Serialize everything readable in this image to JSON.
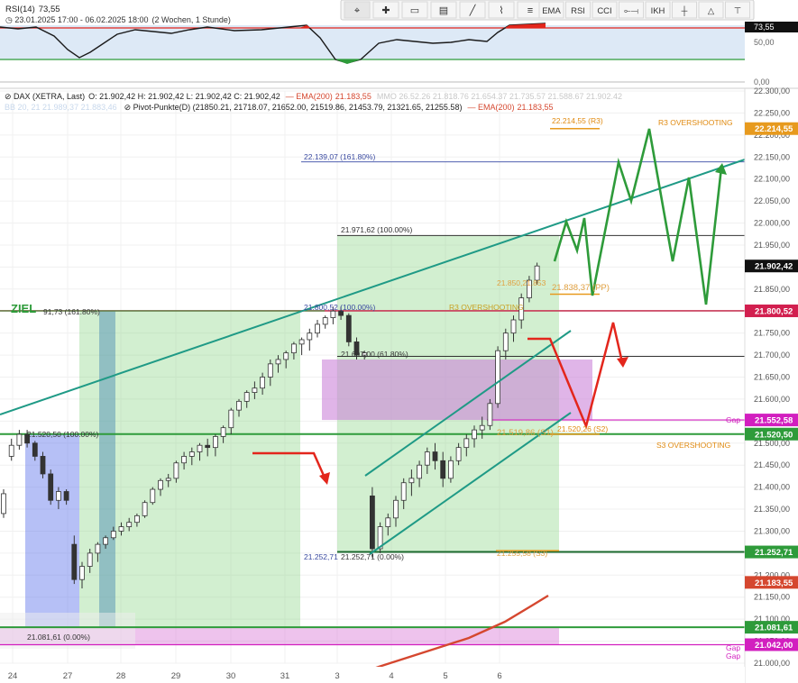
{
  "colors": {
    "green": "#2e9b3a",
    "teal": "#1f9a86",
    "red": "#e3261c",
    "magenta": "#d21fbf",
    "blue_zone": "#4f63e8",
    "green_zone": "#7bcf73",
    "purple_zone": "#a58ec7",
    "ema": "#d5472f",
    "price_tag_bg": "#111111"
  },
  "toolbar": {
    "icons": [
      "cursor-icon",
      "crosshair-icon",
      "rectangle-icon",
      "fibonacci-icon",
      "pencil-icon",
      "brush-icon",
      "lines-icon"
    ],
    "buttons": [
      "EMA",
      "RSI",
      "CCI",
      "⟜⟞",
      "IKH",
      "┼",
      "△",
      "⊤"
    ]
  },
  "rsi": {
    "title": "RSI(14)",
    "value": "73,55",
    "period": "23.01.2025 17:00 - 06.02.2025 18:00",
    "interval": "(2 Wochen, 1 Stunde)",
    "axis": [
      "73,55",
      "50,00",
      "0,00"
    ]
  },
  "legend": {
    "symbol": "DAX (XETRA, Last)",
    "ohlc": "O: 21.902,42  H: 21.902,42  L: 21.902,42  C: 21.902,42",
    "ema_label": "EMA(200)",
    "ema_value": "21.183,55",
    "faded1": "MMO 26.52.26  21.818.76  21.654.37  21.735.57  21.588.67  21.902.42",
    "faded2": "BB 20, 21 21.989,37  21.883,46",
    "pivot": "Pivot-Punkte(D) (21850.21, 21718.07, 21652.00, 21519.86, 21453.79, 21321.65, 21255.58)",
    "ema2_label": "EMA(200)",
    "ema2_value": "21.183,55"
  },
  "chart_data": {
    "type": "candlestick",
    "title": "DAX (XETRA, Last)",
    "ylim": [
      21015,
      22300
    ],
    "y_ticks": [
      "22.300,00",
      "22.250,00",
      "22.200,00",
      "22.150,00",
      "22.100,00",
      "22.050,00",
      "22.000,00",
      "21.950,00",
      "21.900,00",
      "21.850,00",
      "21.800,00",
      "21.750,00",
      "21.700,00",
      "21.650,00",
      "21.600,00",
      "21.550,00",
      "21.500,00",
      "21.450,00",
      "21.400,00",
      "21.350,00",
      "21.300,00",
      "21.250,00",
      "21.200,00",
      "21.150,00",
      "21.100,00",
      "21.050,00",
      "21.000,00"
    ],
    "x_ticks": [
      "24",
      "27",
      "28",
      "29",
      "30",
      "31",
      "3",
      "4",
      "5",
      "6"
    ],
    "price_tags": [
      {
        "label": "22.214,55",
        "value": 22214.55,
        "color": "#e79a1e"
      },
      {
        "label": "21.902,42",
        "value": 21902.42,
        "color": "#111111"
      },
      {
        "label": "21.800,52",
        "value": 21800.52,
        "color": "#d21f4f"
      },
      {
        "label": "21.552,58",
        "value": 21552.58,
        "color": "#d21fbf"
      },
      {
        "label": "21.520,50",
        "value": 21520.5,
        "color": "#2e9b3a"
      },
      {
        "label": "21.252,71",
        "value": 21252.71,
        "color": "#2e9b3a"
      },
      {
        "label": "21.183,55",
        "value": 21183.55,
        "color": "#d5472f"
      },
      {
        "label": "21.081,61",
        "value": 21081.61,
        "color": "#2e9b3a"
      },
      {
        "label": "21.042,00",
        "value": 21042.0,
        "color": "#d21fbf"
      }
    ],
    "annotations": [
      {
        "text": "22.214,55 (R3)",
        "value": 22214.55
      },
      {
        "text": "R3 OVERSHOOTING",
        "value": 22214.55
      },
      {
        "text": "22.139,07 (161.80%)",
        "value": 22139.07
      },
      {
        "text": "21.971,62 (100.00%)",
        "value": 21971.62
      },
      {
        "text": "21.850,21.853",
        "value": 21850.21
      },
      {
        "text": "21.838,37 (PP)",
        "value": 21838.37
      },
      {
        "text": "ZIEL",
        "value": 21800
      },
      {
        "text": "91,73 (161.80%)",
        "value": 21791.73
      },
      {
        "text": "21.800,52 (100.00%)",
        "value": 21800.52
      },
      {
        "text": "R3 OVERSHOOTING",
        "value": 21800
      },
      {
        "text": "21.697,00 (61.80%)",
        "value": 21697.0
      },
      {
        "text": "21.520,50 (100.00%)",
        "value": 21520.5
      },
      {
        "text": "21.519,86 (S1)",
        "value": 21519.86
      },
      {
        "text": "21.520,26 (S2)",
        "value": 21520.26
      },
      {
        "text": "S3 OVERSHOOTING",
        "value": 21515
      },
      {
        "text": "Gap",
        "value": 21560
      },
      {
        "text": "21.252,71",
        "value": 21252.71
      },
      {
        "text": "21.252,71 (0.00%)",
        "value": 21252.71
      },
      {
        "text": "21.255,58 (S3)",
        "value": 21255.58
      },
      {
        "text": "21.081,61 (0.00%)",
        "value": 21081.61
      },
      {
        "text": "Gap",
        "value": 21070
      },
      {
        "text": "Gap",
        "value": 21048
      }
    ],
    "candles": [
      [
        0,
        21340,
        21395,
        21330,
        21385
      ],
      [
        1,
        21470,
        21510,
        21460,
        21495
      ],
      [
        2,
        21495,
        21530,
        21485,
        21520
      ],
      [
        3,
        21520,
        21530,
        21490,
        21500
      ],
      [
        4,
        21500,
        21505,
        21460,
        21470
      ],
      [
        5,
        21470,
        21480,
        21420,
        21430
      ],
      [
        6,
        21430,
        21440,
        21360,
        21370
      ],
      [
        7,
        21370,
        21400,
        21350,
        21390
      ],
      [
        8,
        21390,
        21395,
        21360,
        21370
      ],
      [
        9,
        21270,
        21290,
        21180,
        21190
      ],
      [
        10,
        21190,
        21230,
        21170,
        21220
      ],
      [
        11,
        21220,
        21260,
        21205,
        21250
      ],
      [
        12,
        21250,
        21275,
        21230,
        21270
      ],
      [
        13,
        21270,
        21290,
        21260,
        21285
      ],
      [
        14,
        21285,
        21310,
        21280,
        21300
      ],
      [
        15,
        21300,
        21320,
        21290,
        21310
      ],
      [
        16,
        21310,
        21330,
        21300,
        21320
      ],
      [
        17,
        21320,
        21340,
        21310,
        21335
      ],
      [
        18,
        21335,
        21370,
        21330,
        21365
      ],
      [
        19,
        21365,
        21400,
        21360,
        21395
      ],
      [
        20,
        21395,
        21420,
        21380,
        21415
      ],
      [
        21,
        21415,
        21430,
        21400,
        21420
      ],
      [
        22,
        21420,
        21460,
        21410,
        21455
      ],
      [
        23,
        21455,
        21480,
        21440,
        21470
      ],
      [
        24,
        21470,
        21490,
        21450,
        21480
      ],
      [
        25,
        21480,
        21500,
        21460,
        21495
      ],
      [
        26,
        21495,
        21510,
        21470,
        21490
      ],
      [
        27,
        21490,
        21520,
        21470,
        21515
      ],
      [
        28,
        21515,
        21540,
        21500,
        21535
      ],
      [
        29,
        21535,
        21580,
        21520,
        21575
      ],
      [
        30,
        21575,
        21600,
        21560,
        21595
      ],
      [
        31,
        21595,
        21620,
        21580,
        21615
      ],
      [
        32,
        21615,
        21640,
        21600,
        21625
      ],
      [
        33,
        21625,
        21660,
        21610,
        21650
      ],
      [
        34,
        21650,
        21690,
        21630,
        21680
      ],
      [
        35,
        21680,
        21700,
        21660,
        21690
      ],
      [
        36,
        21690,
        21710,
        21670,
        21705
      ],
      [
        37,
        21705,
        21730,
        21690,
        21725
      ],
      [
        38,
        21725,
        21740,
        21700,
        21735
      ],
      [
        39,
        21735,
        21760,
        21710,
        21750
      ],
      [
        40,
        21750,
        21780,
        21740,
        21770
      ],
      [
        41,
        21770,
        21790,
        21760,
        21785
      ],
      [
        42,
        21785,
        21810,
        21770,
        21800
      ],
      [
        43,
        21800,
        21810,
        21780,
        21790
      ],
      [
        44,
        21790,
        21795,
        21720,
        21730
      ],
      [
        45,
        21730,
        21740,
        21690,
        21700
      ],
      [
        46,
        21700,
        21710,
        21690,
        21705
      ],
      [
        47,
        21380,
        21400,
        21240,
        21260
      ],
      [
        48,
        21260,
        21320,
        21250,
        21310
      ],
      [
        49,
        21310,
        21340,
        21290,
        21330
      ],
      [
        50,
        21330,
        21380,
        21310,
        21370
      ],
      [
        51,
        21370,
        21420,
        21350,
        21410
      ],
      [
        52,
        21410,
        21440,
        21380,
        21420
      ],
      [
        53,
        21420,
        21460,
        21400,
        21450
      ],
      [
        54,
        21450,
        21490,
        21430,
        21480
      ],
      [
        55,
        21480,
        21500,
        21440,
        21460
      ],
      [
        56,
        21460,
        21480,
        21400,
        21420
      ],
      [
        57,
        21420,
        21470,
        21410,
        21460
      ],
      [
        58,
        21460,
        21500,
        21450,
        21490
      ],
      [
        59,
        21490,
        21520,
        21470,
        21510
      ],
      [
        60,
        21510,
        21540,
        21490,
        21530
      ],
      [
        61,
        21530,
        21560,
        21510,
        21540
      ],
      [
        62,
        21540,
        21600,
        21530,
        21590
      ],
      [
        63,
        21590,
        21720,
        21580,
        21710
      ],
      [
        64,
        21710,
        21760,
        21690,
        21750
      ],
      [
        65,
        21750,
        21790,
        21730,
        21780
      ],
      [
        66,
        21780,
        21840,
        21760,
        21830
      ],
      [
        67,
        21830,
        21880,
        21820,
        21870
      ],
      [
        68,
        21870,
        21910,
        21860,
        21902.42
      ]
    ]
  }
}
